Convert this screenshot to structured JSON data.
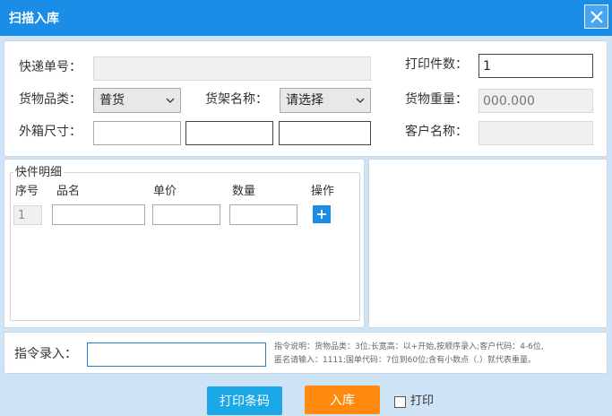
{
  "window": {
    "title": "扫描入库"
  },
  "form": {
    "tracking_number": {
      "label": "快递单号：",
      "value": ""
    },
    "print_count": {
      "label": "打印件数：",
      "value": "1"
    },
    "goods_category": {
      "label": "货物品类：",
      "selected": "普货"
    },
    "shelf_name": {
      "label": "货架名称：",
      "selected": "请选择"
    },
    "goods_weight": {
      "label": "货物重量：",
      "placeholder": "000.000"
    },
    "box_size": {
      "label": "外箱尺寸：",
      "length": "",
      "width": "",
      "height": ""
    },
    "customer_name": {
      "label": "客户名称：",
      "value": ""
    }
  },
  "items": {
    "legend": "快件明细",
    "columns": [
      "序号",
      "品名",
      "单价",
      "数量",
      "操作"
    ],
    "rows": [
      {
        "index": "1",
        "name": "",
        "price": "",
        "qty": ""
      }
    ]
  },
  "command": {
    "label": "指令录入：",
    "value": "",
    "hint_line1": "指令说明：货物品类：3位;长宽高：以+开始,按顺序录入;客户代码：4-6位,",
    "hint_line2": "匿名请输入：1111;国单代码：7位到60位;含有小数点（.）就代表重量。"
  },
  "actions": {
    "print_barcode": "打印条码",
    "stock_in": "入库",
    "print_checkbox": "打印"
  },
  "colors": {
    "titlebar": "#1a8ee6",
    "print_button": "#1aa9e6",
    "stock_in_button": "#ff8a0d"
  }
}
